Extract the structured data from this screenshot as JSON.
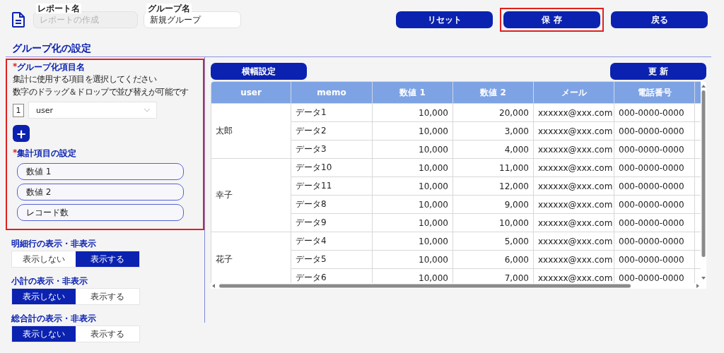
{
  "header": {
    "report_name": {
      "label": "レポート名",
      "placeholder": "レポートの作成",
      "disabled": true
    },
    "group_name": {
      "label": "グループ名",
      "value": "新規グループ"
    },
    "actions": [
      {
        "label": "リセット",
        "highlighted": false
      },
      {
        "label": "保 存",
        "highlighted": true
      },
      {
        "label": "戻る",
        "highlighted": false
      }
    ]
  },
  "title": "グループ化の設定",
  "group_settings": {
    "highlighted": true,
    "group_items": {
      "label": "グループ化項目名",
      "required": true,
      "required_mark": "*",
      "help": [
        "集計に使用する項目を選択してください",
        "数字のドラッグ＆ドロップで並び替えが可能です"
      ],
      "rows": [
        {
          "number": "1",
          "value": "user"
        }
      ],
      "add_button": "+"
    },
    "aggregate_items": {
      "label": "集計項目の設定",
      "required": true,
      "required_mark": "*",
      "items": [
        "数値 1",
        "数値 2",
        "レコード数"
      ]
    }
  },
  "toggles": [
    {
      "label": "明細行の表示・非表示",
      "options": [
        {
          "label": "表示しない",
          "selected": false
        },
        {
          "label": "表示する",
          "selected": true
        }
      ]
    },
    {
      "label": "小計の表示・非表示",
      "options": [
        {
          "label": "表示しない",
          "selected": true
        },
        {
          "label": "表示する",
          "selected": false
        }
      ]
    },
    {
      "label": "総合計の表示・非表示",
      "options": [
        {
          "label": "表示しない",
          "selected": true
        },
        {
          "label": "表示する",
          "selected": false
        }
      ]
    }
  ],
  "table_toolbar": {
    "width_button": "横幅設定",
    "refresh_button": "更 新"
  },
  "table": {
    "columns": [
      "user",
      "memo",
      "数値 1",
      "数値 2",
      "メール",
      "電話番号"
    ],
    "groups": [
      {
        "user": "太郎",
        "rows": [
          [
            "データ1",
            "10,000",
            "20,000",
            "xxxxxx@xxx.com",
            "000-0000-0000"
          ],
          [
            "データ2",
            "10,000",
            "3,000",
            "xxxxxx@xxx.com",
            "000-0000-0000"
          ],
          [
            "データ3",
            "10,000",
            "4,000",
            "xxxxxx@xxx.com",
            "000-0000-0000"
          ]
        ]
      },
      {
        "user": "幸子",
        "rows": [
          [
            "データ10",
            "10,000",
            "11,000",
            "xxxxxx@xxx.com",
            "000-0000-0000"
          ],
          [
            "データ11",
            "10,000",
            "12,000",
            "xxxxxx@xxx.com",
            "000-0000-0000"
          ],
          [
            "データ8",
            "10,000",
            "9,000",
            "xxxxxx@xxx.com",
            "000-0000-0000"
          ],
          [
            "データ9",
            "10,000",
            "10,000",
            "xxxxxx@xxx.com",
            "000-0000-0000"
          ]
        ]
      },
      {
        "user": "花子",
        "rows": [
          [
            "データ4",
            "10,000",
            "5,000",
            "xxxxxx@xxx.com",
            "000-0000-0000"
          ],
          [
            "データ5",
            "10,000",
            "6,000",
            "xxxxxx@xxx.com",
            "000-0000-0000"
          ],
          [
            "データ6",
            "10,000",
            "7,000",
            "xxxxxx@xxx.com",
            "000-0000-0000"
          ]
        ]
      }
    ]
  }
}
